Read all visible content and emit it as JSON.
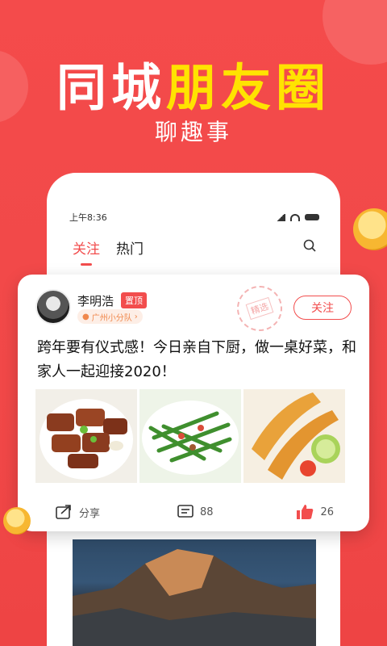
{
  "headline": {
    "part1": "同城",
    "part2": "朋友圈"
  },
  "subtitle": "聊趣事",
  "phone": {
    "status_time": "上午8:36",
    "tabs": [
      "关注",
      "热门"
    ]
  },
  "post": {
    "username": "李明浩",
    "pin_label": "置顶",
    "team": "广州小分队",
    "stamp_text": "精选",
    "follow_label": "关注",
    "text": "跨年要有仪式感！今日亲自下厨，做一桌好菜，和家人一起迎接2020！",
    "actions": {
      "share": "分享",
      "comments": "88",
      "likes": "26"
    }
  },
  "colors": {
    "brand": "#f24d4d",
    "accent": "#ffe300"
  },
  "icons": [
    "search-icon",
    "share-icon",
    "comment-icon",
    "like-icon",
    "person-icon",
    "chevron-right-icon"
  ]
}
